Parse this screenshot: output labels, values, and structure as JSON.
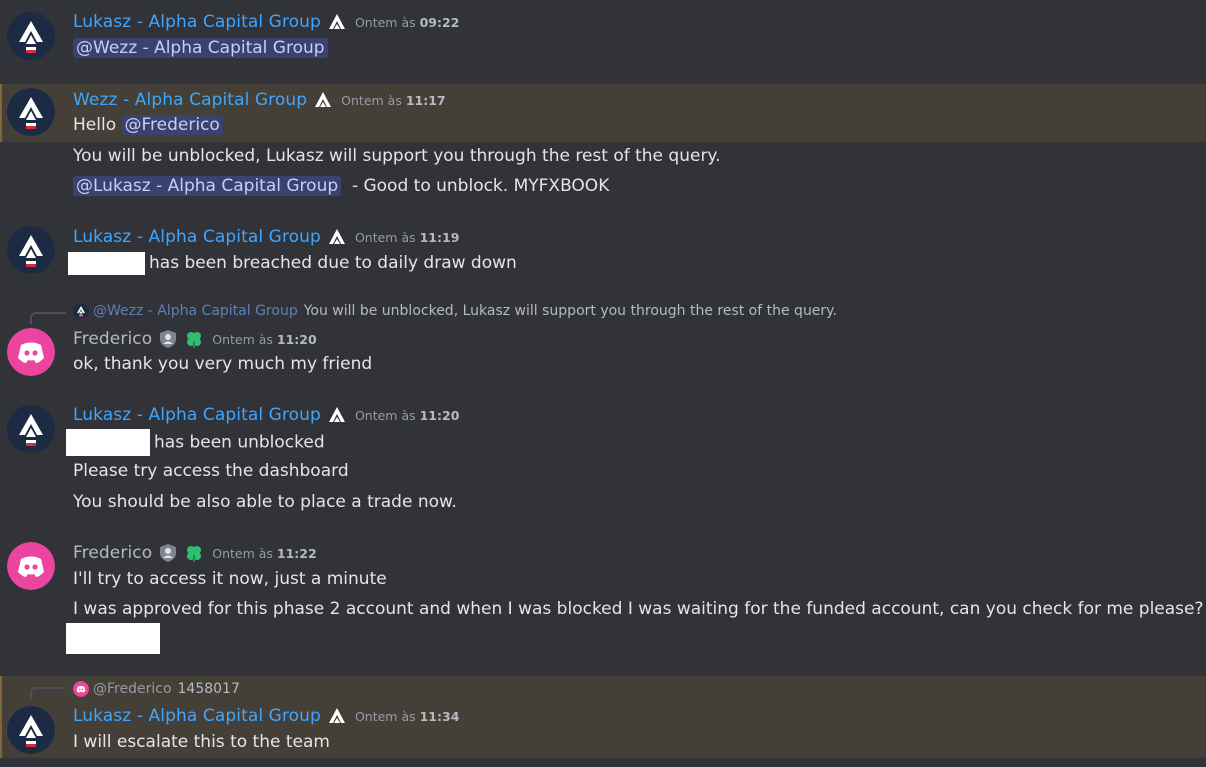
{
  "colors": {
    "background": "#313338",
    "highlight_background": "#444038",
    "username_staff": "#3ea6ff",
    "username_user": "#b5bac1",
    "mention_bg": "#3c4270",
    "mention_text": "#c9cdfb",
    "discord_pink": "#eb459f"
  },
  "messages": [
    {
      "author": "Lukasz - Alpha Capital Group",
      "time_prefix": "Ontem às ",
      "time": "09:22",
      "lines": {
        "l1": "@Wezz - Alpha Capital Group"
      }
    },
    {
      "author": "Wezz - Alpha Capital Group",
      "time_prefix": "Ontem às ",
      "time": "11:17",
      "lines": {
        "l1_text": "Hello ",
        "l1_mention": "@Frederico",
        "l2": "You will be unblocked, Lukasz will support you through the rest of the query.",
        "l3_mention": "@Lukasz - Alpha Capital Group",
        "l3_text": "  - Good to unblock. MYFXBOOK"
      }
    },
    {
      "author": "Lukasz - Alpha Capital Group",
      "time_prefix": "Ontem às ",
      "time": "11:19",
      "lines": {
        "l1": "has been breached due to daily draw down"
      }
    },
    {
      "reply_to": "@Wezz - Alpha Capital Group",
      "reply_text": "You will be unblocked, Lukasz will support you through the rest of the query.",
      "author": "Frederico",
      "time_prefix": "Ontem às ",
      "time": "11:20",
      "lines": {
        "l1": "ok, thank you very much my friend"
      }
    },
    {
      "author": "Lukasz - Alpha Capital Group",
      "time_prefix": "Ontem às ",
      "time": "11:20",
      "lines": {
        "l1": "has been unblocked",
        "l2": "Please try access the dashboard",
        "l3": "You should be also able to place a trade now."
      }
    },
    {
      "author": "Frederico",
      "time_prefix": "Ontem às ",
      "time": "11:22",
      "lines": {
        "l1": "I'll try to access it now, just a minute",
        "l2": "I was approved for this phase 2 account and when I was blocked I was waiting for the funded account, can you check for me please?"
      }
    },
    {
      "reply_to": "@Frederico",
      "reply_text": "1458017",
      "author": "Lukasz - Alpha Capital Group",
      "time_prefix": "Ontem às ",
      "time": "11:34",
      "lines": {
        "l1": "I will escalate this to the team"
      }
    }
  ]
}
